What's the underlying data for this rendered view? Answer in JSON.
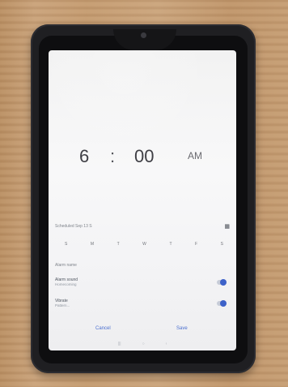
{
  "status_bar": {
    "time": ""
  },
  "time_picker": {
    "hour": "6",
    "separator": ":",
    "minute": "00",
    "ampm": "AM"
  },
  "repeat": {
    "label": "Scheduled Sep 13 S",
    "days": [
      "S",
      "M",
      "T",
      "W",
      "T",
      "F",
      "S"
    ]
  },
  "settings": {
    "alarm_name": "Alarm name",
    "alarm_sound": {
      "title": "Alarm sound",
      "subtitle": "Homecoming"
    },
    "vibration": {
      "title": "Vibrate",
      "subtitle": "Pattern..."
    }
  },
  "actions": {
    "cancel": "Cancel",
    "save": "Save"
  },
  "colors": {
    "accent": "#3d62c9",
    "device_case": "#1f1f22",
    "tablecloth": "#c49b70"
  }
}
